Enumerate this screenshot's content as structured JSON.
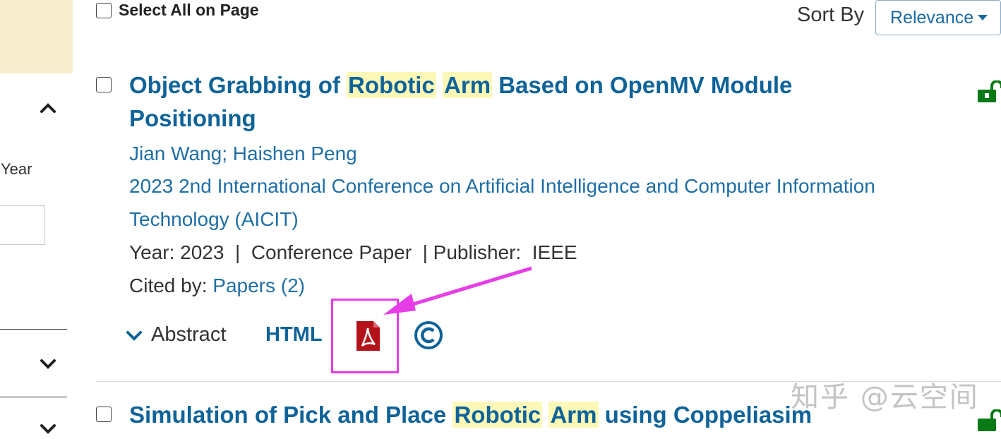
{
  "sidebar": {
    "year_label": "Year"
  },
  "toolbar": {
    "select_all_label": "Select All on Page",
    "sort_by_label": "Sort By",
    "sort_value": "Relevance"
  },
  "results": [
    {
      "title_pre": "Object Grabbing of ",
      "title_hl1": "Robotic",
      "title_hl2": "Arm",
      "title_post": " Based on OpenMV Module",
      "title_line2": "Positioning",
      "authors": "Jian Wang; Haishen Peng",
      "venue_line1": "2023 2nd International Conference on Artificial Intelligence and Computer Information",
      "venue_line2": "Technology (AICIT)",
      "meta": "Year: 2023  |  Conference Paper  | Publisher:  IEEE",
      "cited_by_label": "Cited by: ",
      "cited_by_link": "Papers (2)",
      "abstract_label": "Abstract",
      "html_label": "HTML"
    },
    {
      "title_pre": "Simulation of Pick and Place ",
      "title_hl1": "Robotic",
      "title_hl2": "Arm",
      "title_post": " using Coppeliasim"
    }
  ],
  "watermark": "知乎 @云空间",
  "colors": {
    "accent": "#0f6399",
    "highlight": "#fcf8b8",
    "annotation": "#e63de6",
    "pdf_red": "#b3121a",
    "open_access_green": "#0a7a16"
  }
}
